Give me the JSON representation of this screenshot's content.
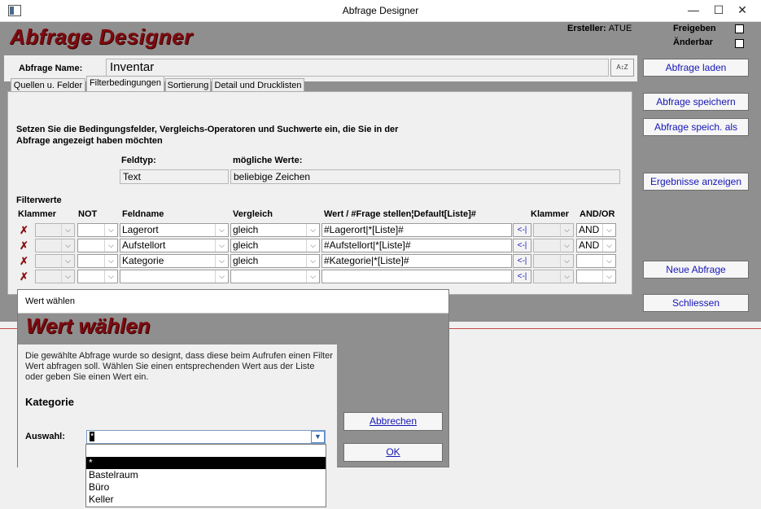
{
  "window": {
    "title": "Abfrage Designer",
    "controls": {
      "minimize": "—",
      "maximize": "☐",
      "close": "✕"
    }
  },
  "form": {
    "heading": "Abfrage Designer",
    "creator_label": "Ersteller:",
    "creator_value": "ATUE",
    "release_label": "Freigeben",
    "changeable_label": "Änderbar",
    "query_name_label": "Abfrage Name:",
    "query_name_value": "Inventar",
    "sort_button_label": "A↕Z"
  },
  "right_buttons": {
    "load": "Abfrage laden",
    "save": "Abfrage speichern",
    "save_as": "Abfrage speich. als",
    "show_results": "Ergebnisse anzeigen",
    "new": "Neue Abfrage",
    "close": "Schliessen"
  },
  "tabs": [
    {
      "label": "Quellen u. Felder",
      "active": false
    },
    {
      "label": "Filterbedingungen",
      "active": true
    },
    {
      "label": "Sortierung",
      "active": false
    },
    {
      "label": "Detail und Drucklisten",
      "active": false
    }
  ],
  "filter_tab": {
    "instructions_line1": "Setzen Sie die Bedingungsfelder, Vergleichs-Operatoren und Suchwerte ein, die Sie in der",
    "instructions_line2": "Abfrage angezeigt haben möchten",
    "field_type_label": "Feldtyp:",
    "field_type_value": "Text",
    "possible_values_label": "mögliche Werte:",
    "possible_values_value": "beliebige Zeichen",
    "filter_values_label": "Filterwerte",
    "columns": {
      "bracket_open": "Klammer",
      "not": "NOT",
      "field": "Feldname",
      "compare": "Vergleich",
      "value": "Wert / #Frage stellen¦Default[Liste]#",
      "bracket_close": "Klammer",
      "andor": "AND/OR"
    },
    "pick_label": "<-|",
    "rows": [
      {
        "field": "Lagerort",
        "compare": "gleich",
        "value": "#Lagerort|*[Liste]#",
        "andor": "AND"
      },
      {
        "field": "Aufstellort",
        "compare": "gleich",
        "value": "#Aufstellort|*[Liste]#",
        "andor": "AND"
      },
      {
        "field": "Kategorie",
        "compare": "gleich",
        "value": "#Kategorie|*[Liste]#",
        "andor": ""
      },
      {
        "field": "",
        "compare": "",
        "value": "",
        "andor": ""
      }
    ]
  },
  "dialog": {
    "title": "Wert wählen",
    "heading": "Wert wählen",
    "description": "Die gewählte Abfrage wurde so designt, dass diese beim Aufrufen einen Filter Wert abfragen soll. Wählen Sie einen entsprechenden Wert aus der Liste oder geben Sie einen Wert ein.",
    "category": "Kategorie",
    "selection_label": "Auswahl:",
    "selection_value": "*",
    "cancel_button": "Abbrechen",
    "ok_button": "OK",
    "options": [
      "",
      "*",
      "Bastelraum",
      "Büro",
      "Keller"
    ],
    "selected_option_index": 1
  }
}
